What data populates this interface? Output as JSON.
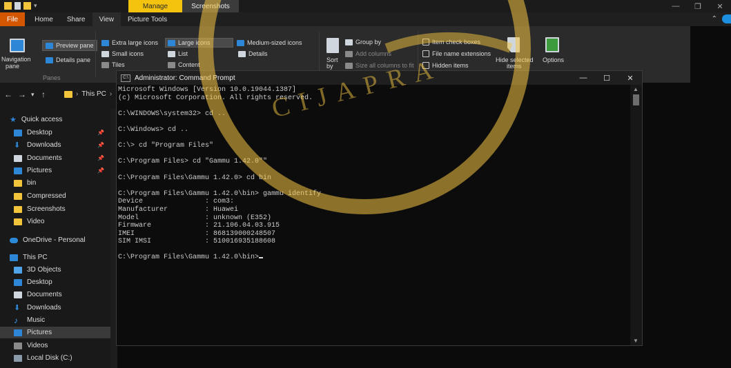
{
  "explorer": {
    "context_tab": "Manage",
    "context_title": "Screenshots",
    "tabs": [
      "File",
      "Home",
      "Share",
      "View",
      "Picture Tools"
    ],
    "ribbon": {
      "panes": {
        "preview": "Preview pane",
        "details": "Details pane",
        "navigation": "Navigation",
        "navigation2": "pane",
        "group_label": "Panes"
      },
      "layout": {
        "extra_large": "Extra large icons",
        "large": "Large icons",
        "medium": "Medium-sized icons",
        "small": "Small icons",
        "list": "List",
        "details": "Details",
        "tiles": "Tiles",
        "content": "Content"
      },
      "current_view": {
        "sort": "Sort",
        "sort2": "by",
        "group_by": "Group by",
        "add_columns": "Add columns",
        "size_all": "Size all columns to fit"
      },
      "show_hide": {
        "item_check": "Item check boxes",
        "extensions": "File name extensions",
        "hidden": "Hidden items",
        "hide_selected": "Hide selected",
        "hide_selected2": "items",
        "options": "Options"
      }
    },
    "address": {
      "crumb": "This PC"
    },
    "nav": {
      "quick_access": "Quick access",
      "pinned": [
        "Desktop",
        "Downloads",
        "Documents",
        "Pictures"
      ],
      "folders": [
        "bin",
        "Compressed",
        "Screenshots",
        "Video"
      ],
      "onedrive": "OneDrive - Personal",
      "this_pc": "This PC",
      "pc_items": [
        "3D Objects",
        "Desktop",
        "Documents",
        "Downloads",
        "Music",
        "Pictures",
        "Videos",
        "Local Disk (C:)"
      ]
    }
  },
  "cmd": {
    "title": "Administrator: Command Prompt",
    "icon_label": "C:\\",
    "lines": [
      "Microsoft Windows [Version 10.0.19044.1387]",
      "(c) Microsoft Corporation. All rights reserved.",
      "",
      "C:\\WINDOWS\\system32> cd ..",
      "",
      "C:\\Windows> cd ..",
      "",
      "C:\\> cd \"Program Files\"",
      "",
      "C:\\Program Files> cd \"Gammu 1.42.0\"\"",
      "",
      "C:\\Program Files\\Gammu 1.42.0> cd bin",
      "",
      "C:\\Program Files\\Gammu 1.42.0\\bin> gammu identify",
      "Device               : com3:",
      "Manufacturer         : Huawei",
      "Model                : unknown (E352)",
      "Firmware             : 21.106.04.03.915",
      "IMEI                 : 868139000248507",
      "SIM IMSI             : 510016935188608",
      "",
      "C:\\Program Files\\Gammu 1.42.0\\bin>"
    ]
  },
  "watermark": {
    "text": "CIJAPRA"
  }
}
